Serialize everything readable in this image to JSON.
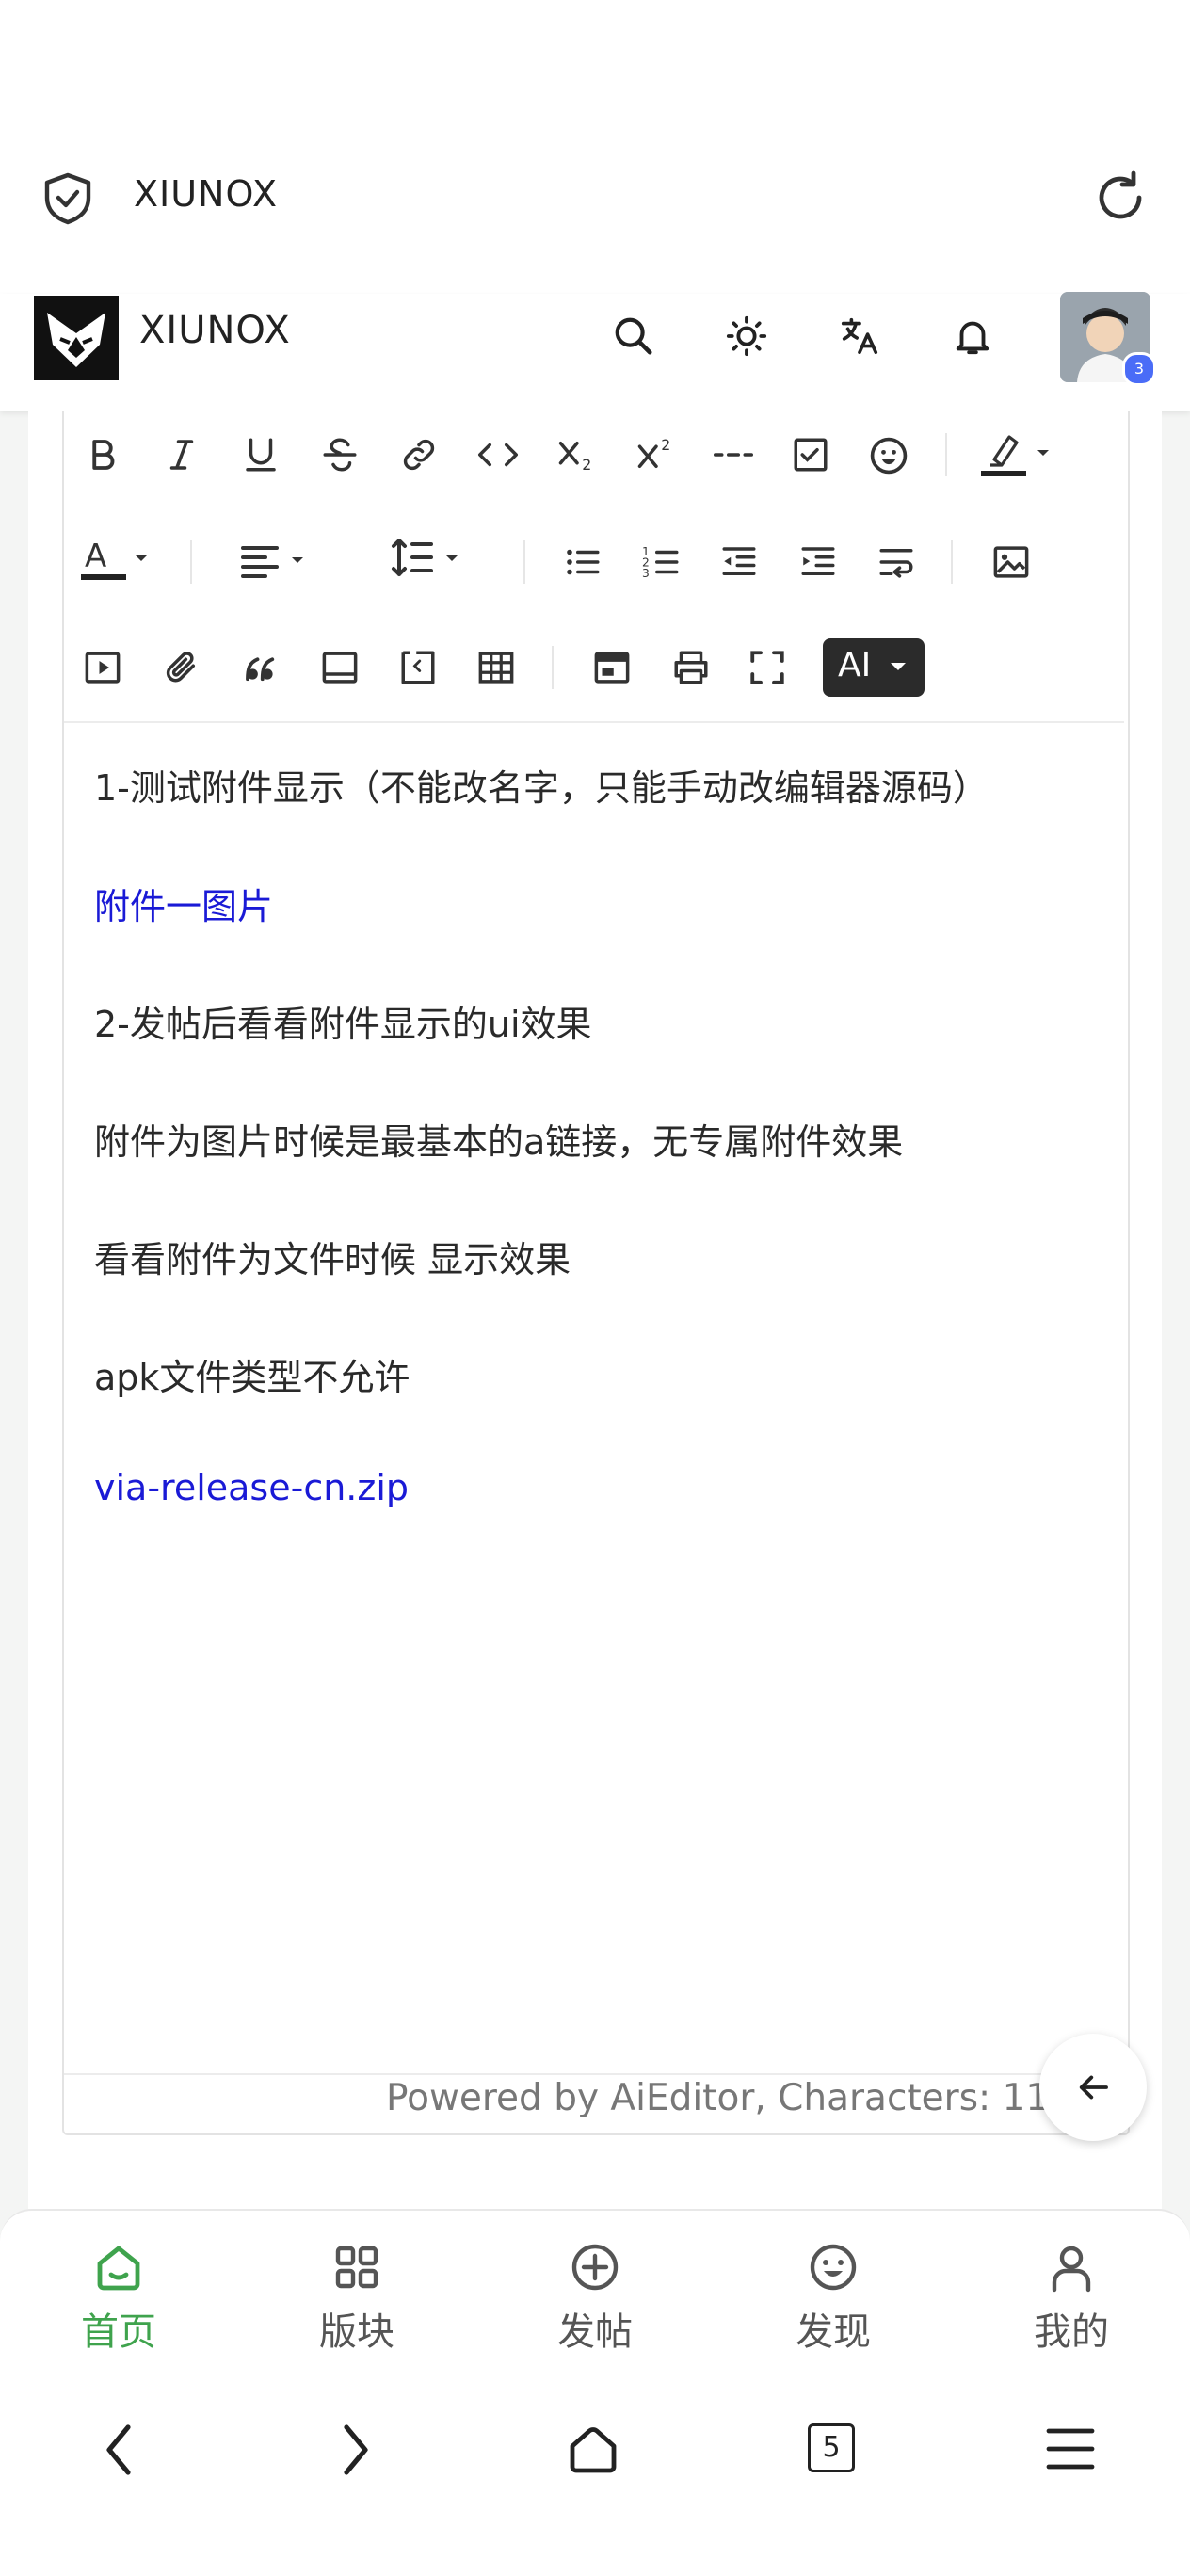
{
  "browser": {
    "title": "XIUNOX",
    "icons": {
      "shield": "shield-check-icon",
      "reload": "reload-icon"
    }
  },
  "site": {
    "title": "XIUNOX",
    "avatar_badge": "3",
    "icons": [
      "search-icon",
      "brightness-icon",
      "translate-icon",
      "bell-icon"
    ]
  },
  "toolbar": {
    "ai_label": "AI",
    "rows": [
      [
        "bold",
        "italic",
        "underline",
        "strikethrough",
        "link",
        "code",
        "subscript",
        "superscript",
        "horizontal-rule",
        "task-list",
        "emoji",
        "highlight"
      ],
      [
        "font-color",
        "align",
        "line-height",
        "bullet-list",
        "ordered-list",
        "outdent",
        "indent",
        "line-break",
        "image"
      ],
      [
        "video",
        "attachment",
        "quote",
        "container",
        "code-block",
        "table",
        "template",
        "print",
        "fullscreen",
        "ai"
      ]
    ]
  },
  "content": {
    "lines": [
      "1-测试附件显示（不能改名字，只能手动改编辑器源码）",
      "附件一图片",
      "2-发帖后看看附件显示的ui效果",
      "附件为图片时候是最基本的a链接，无专属附件效果",
      "看看附件为文件时候 显示效果",
      "apk文件类型不允许",
      "via-release-cn.zip"
    ]
  },
  "editor_footer": {
    "powered_by": "Powered by AiEditor, Characters: 11"
  },
  "tabs": [
    {
      "label": "首页",
      "icon": "home-icon",
      "active": true
    },
    {
      "label": "版块",
      "icon": "grid-icon",
      "active": false
    },
    {
      "label": "发帖",
      "icon": "plus-circle-icon",
      "active": false
    },
    {
      "label": "发现",
      "icon": "smile-icon",
      "active": false
    },
    {
      "label": "我的",
      "icon": "user-icon",
      "active": false
    }
  ],
  "navbar": {
    "tab_count": "5"
  },
  "colors": {
    "accent": "#3fa34d",
    "link": "#1a1ad6",
    "ai_button": "#2b2b2b"
  }
}
